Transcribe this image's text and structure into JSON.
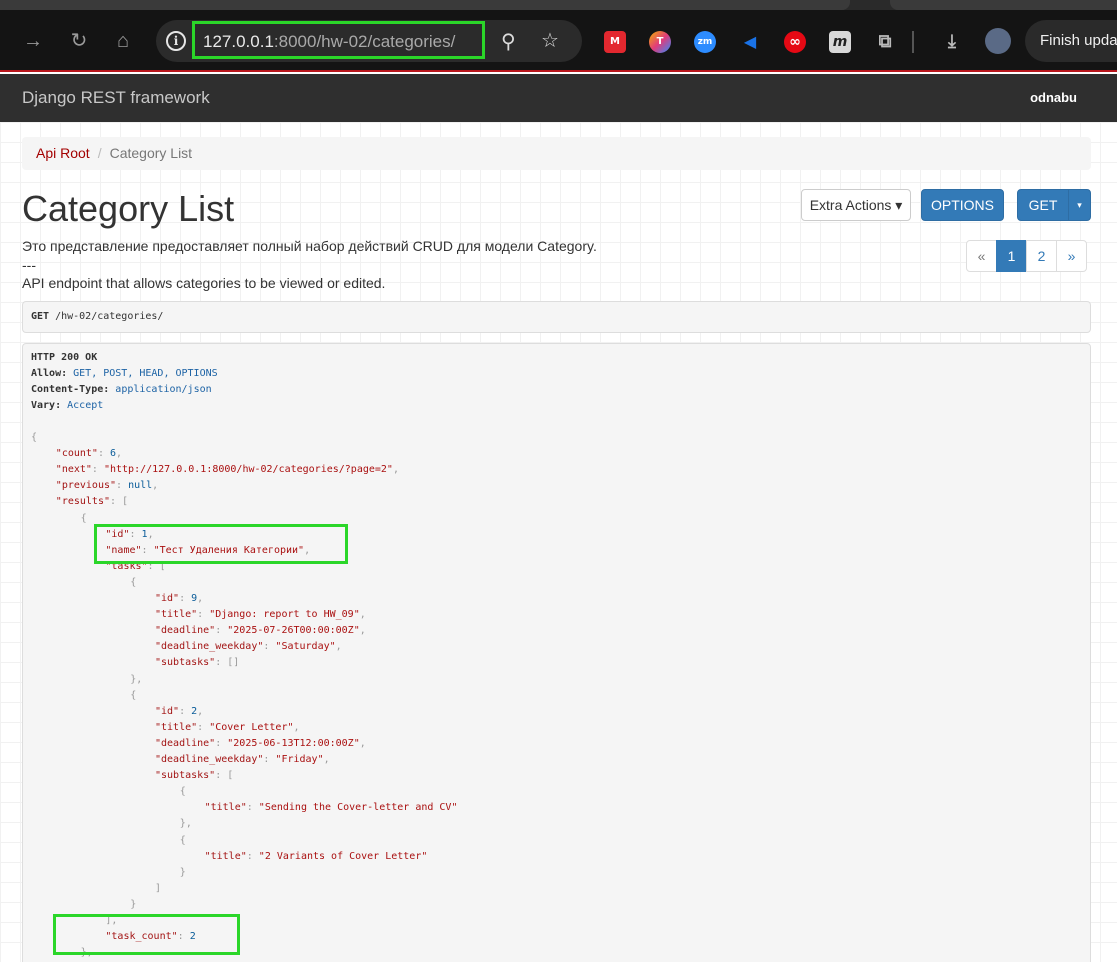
{
  "browser": {
    "url_host": "127.0.0.1",
    "url_rest": ":8000/hw-02/categories/",
    "finish_label": "Finish update",
    "extensions": [
      {
        "name": "mendeley-icon",
        "label": "M",
        "color": "#e3282f"
      },
      {
        "name": "tune-icon",
        "label": "T",
        "color": "#f2b200"
      },
      {
        "name": "zoom-icon",
        "label": "zm",
        "color": "#2d8cff"
      },
      {
        "name": "megaphone-icon",
        "label": "📢",
        "color": "#1a73e8"
      },
      {
        "name": "infinity-icon",
        "label": "∞",
        "color": "#e50914"
      },
      {
        "name": "m-icon",
        "label": "m",
        "color": "#555555"
      }
    ]
  },
  "navbar": {
    "brand": "Django REST framework",
    "user": "odnabu"
  },
  "breadcrumb": {
    "root": "Api Root",
    "separator": "/",
    "current": "Category List"
  },
  "page": {
    "title": "Category List",
    "desc_line1": "Это представление предоставляет полный набор действий CRUD для модели Category.",
    "desc_line2": "---",
    "desc_line3": "API endpoint that allows categories to be viewed or edited.",
    "buttons": {
      "extra_actions": "Extra Actions ▾",
      "options": "OPTIONS",
      "get": "GET",
      "get_caret": "▾"
    },
    "pagination": [
      "«",
      "1",
      "2",
      "»"
    ],
    "request": {
      "method": "GET",
      "path": " /hw-02/categories/"
    }
  },
  "response": {
    "status": "HTTP 200 OK",
    "headers": [
      {
        "name": "Allow:",
        "value": " GET, POST, HEAD, OPTIONS"
      },
      {
        "name": "Content-Type:",
        "value": " application/json"
      },
      {
        "name": "Vary:",
        "value": " Accept"
      }
    ]
  }
}
